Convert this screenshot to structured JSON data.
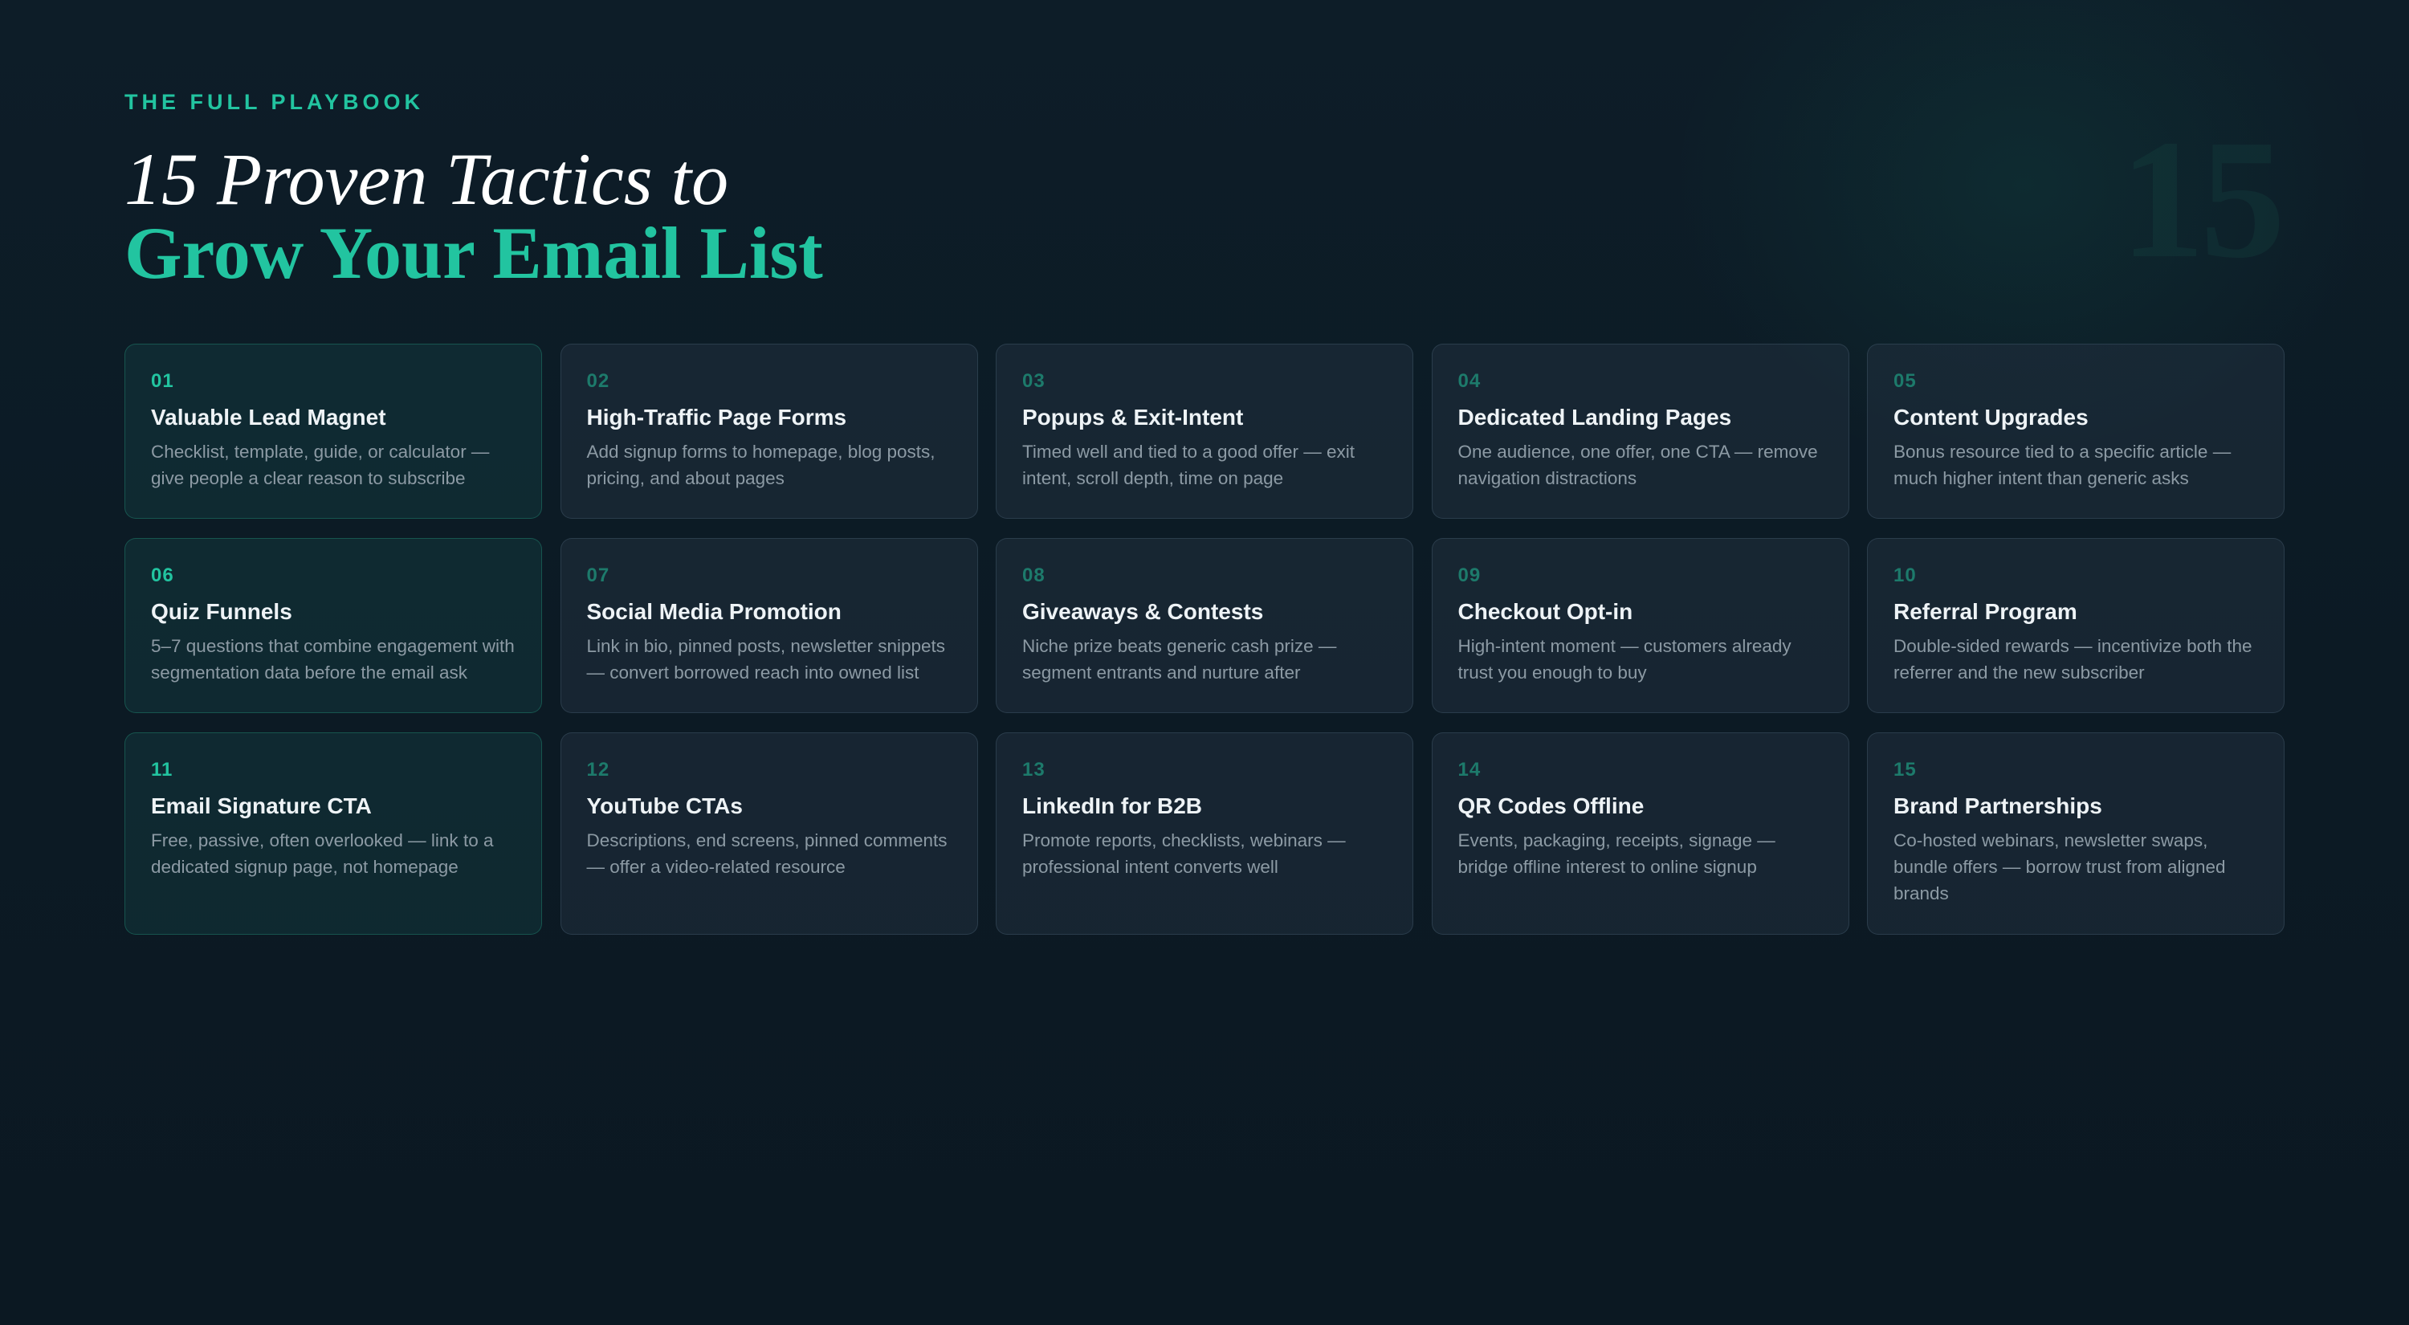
{
  "decor": {
    "big_number": "15"
  },
  "header": {
    "eyebrow": "THE FULL PLAYBOOK",
    "title_line1": "15 Proven Tactics to",
    "title_line2": "Grow Your Email List"
  },
  "colors": {
    "accent": "#22c4a0",
    "background": "#0c1a24",
    "card": "#1a2a36",
    "muted_number": "#1d7a6b"
  },
  "cards": [
    {
      "num": "01",
      "title": "Valuable Lead Magnet",
      "desc": "Checklist, template, guide, or calculator — give people a clear reason to subscribe"
    },
    {
      "num": "02",
      "title": "High-Traffic Page Forms",
      "desc": "Add signup forms to homepage, blog posts, pricing, and about pages"
    },
    {
      "num": "03",
      "title": "Popups & Exit-Intent",
      "desc": "Timed well and tied to a good offer — exit intent, scroll depth, time on page"
    },
    {
      "num": "04",
      "title": "Dedicated Landing Pages",
      "desc": "One audience, one offer, one CTA — remove navigation distractions"
    },
    {
      "num": "05",
      "title": "Content Upgrades",
      "desc": "Bonus resource tied to a specific article — much higher intent than generic asks"
    },
    {
      "num": "06",
      "title": "Quiz Funnels",
      "desc": "5–7 questions that combine engagement with segmentation data before the email ask"
    },
    {
      "num": "07",
      "title": "Social Media Promotion",
      "desc": "Link in bio, pinned posts, newsletter snippets — convert borrowed reach into owned list"
    },
    {
      "num": "08",
      "title": "Giveaways & Contests",
      "desc": "Niche prize beats generic cash prize — segment entrants and nurture after"
    },
    {
      "num": "09",
      "title": "Checkout Opt-in",
      "desc": "High-intent moment — customers already trust you enough to buy"
    },
    {
      "num": "10",
      "title": "Referral Program",
      "desc": "Double-sided rewards — incentivize both the referrer and the new subscriber"
    },
    {
      "num": "11",
      "title": "Email Signature CTA",
      "desc": "Free, passive, often overlooked — link to a dedicated signup page, not homepage"
    },
    {
      "num": "12",
      "title": "YouTube CTAs",
      "desc": "Descriptions, end screens, pinned comments — offer a video-related resource"
    },
    {
      "num": "13",
      "title": "LinkedIn for B2B",
      "desc": "Promote reports, checklists, webinars — professional intent converts well"
    },
    {
      "num": "14",
      "title": "QR Codes Offline",
      "desc": "Events, packaging, receipts, signage — bridge offline interest to online signup"
    },
    {
      "num": "15",
      "title": "Brand Partnerships",
      "desc": "Co-hosted webinars, newsletter swaps, bundle offers — borrow trust from aligned brands"
    }
  ]
}
